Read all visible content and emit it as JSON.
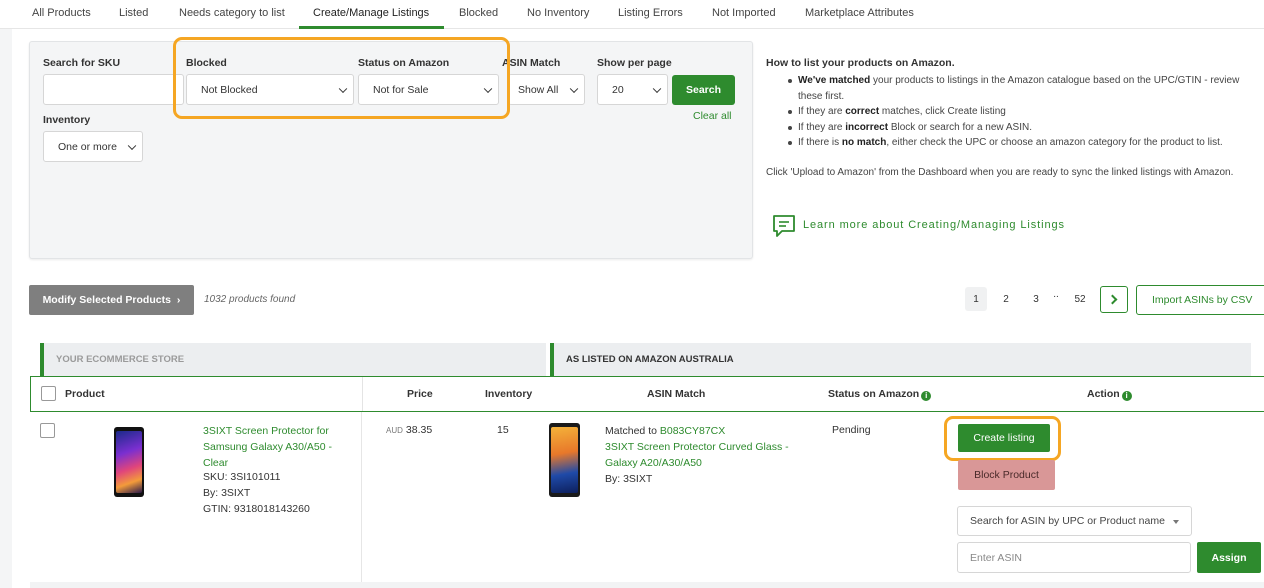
{
  "tabs": [
    {
      "label": "All Products"
    },
    {
      "label": "Listed"
    },
    {
      "label": "Needs category to list"
    },
    {
      "label": "Create/Manage Listings",
      "active": true
    },
    {
      "label": "Blocked"
    },
    {
      "label": "No Inventory"
    },
    {
      "label": "Listing Errors"
    },
    {
      "label": "Not Imported"
    },
    {
      "label": "Marketplace Attributes"
    }
  ],
  "filters": {
    "sku_label": "Search for SKU",
    "sku_value": "",
    "blocked_label": "Blocked",
    "blocked_value": "Not Blocked",
    "status_label": "Status on Amazon",
    "status_value": "Not for Sale",
    "asin_label": "ASIN Match",
    "asin_value": "Show All",
    "perpage_label": "Show per page",
    "perpage_value": "20",
    "search_button": "Search",
    "clear_link": "Clear all",
    "inventory_label": "Inventory",
    "inventory_value": "One or more"
  },
  "help": {
    "title": "How to list your products on Amazon.",
    "items": [
      {
        "bold": "We've matched",
        "text": " your products to listings in the Amazon catalogue based on the UPC/GTIN - review these first."
      },
      {
        "pre": "If they are ",
        "bold": "correct",
        "text": " matches, click Create listing"
      },
      {
        "pre": "If they are ",
        "bold": "incorrect",
        "text": " Block or search for a new ASIN."
      },
      {
        "pre": "If there is ",
        "bold": "no match",
        "text": ", either check the UPC or choose an amazon category for the product to list."
      }
    ],
    "note": "Click 'Upload to Amazon' from the Dashboard when you are ready to sync the linked listings with Amazon.",
    "learn_link": "Learn more about Creating/Managing Listings"
  },
  "toolbar": {
    "modify_button": "Modify Selected Products",
    "modify_chevron": "›",
    "found_text": "1032 products found",
    "pages": [
      "1",
      "2",
      "3",
      "52"
    ],
    "ellipsis": "..",
    "import_button": "Import ASINs by CSV"
  },
  "sections": {
    "store": "Your Ecommerce Store",
    "amazon": "As listed on Amazon Australia"
  },
  "columns": {
    "product": "Product",
    "price": "Price",
    "inventory": "Inventory",
    "asin_match": "ASIN Match",
    "status": "Status on Amazon",
    "action": "Action",
    "info_glyph": "i"
  },
  "rows": [
    {
      "name": "3SIXT Screen Protector for Samsung Galaxy A30/A50 - Clear",
      "sku": "SKU: 3SI101011",
      "by": "By: 3SIXT",
      "gtin": "GTIN: 9318018143260",
      "currency": "AUD",
      "price": "38.35",
      "inventory": "15",
      "matched_prefix": "Matched to ",
      "asin": "B083CY87CX",
      "match_title": "3SIXT Screen Protector Curved Glass - Galaxy A20/A30/A50",
      "match_by": "By: 3SIXT",
      "status": "Pending",
      "create_button": "Create listing",
      "block_button": "Block Product",
      "search_asin_placeholder": "Search for ASIN by UPC or Product name",
      "asin_input_placeholder": "Enter ASIN",
      "assign_button": "Assign"
    }
  ],
  "colors": {
    "accent_green": "#2e8b2e",
    "highlight_orange": "#f5a623",
    "block_red": "#d99797",
    "grey_button": "#7f7f7f"
  }
}
